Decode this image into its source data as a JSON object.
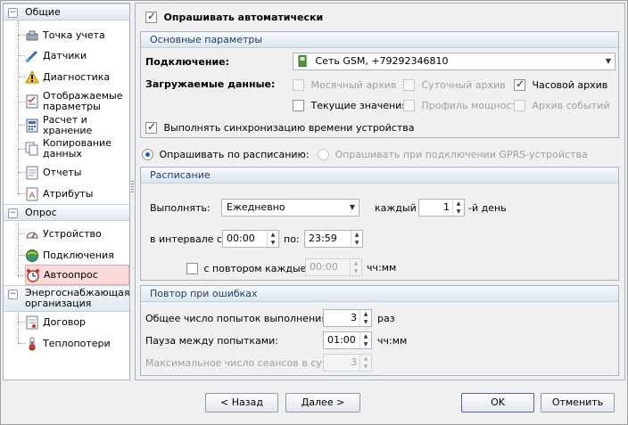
{
  "sidebar": {
    "groups": [
      {
        "label": "Общие",
        "toggle": "−"
      },
      {
        "label": "Опрос",
        "toggle": "−"
      },
      {
        "label": "Энергоснабжающая организация",
        "toggle": "−"
      }
    ],
    "items": [
      {
        "label": "Точка учета",
        "icon": "meter-point-icon"
      },
      {
        "label": "Датчики",
        "icon": "sensor-icon"
      },
      {
        "label": "Диагностика",
        "icon": "warning-icon"
      },
      {
        "label": "Отображаемые параметры",
        "icon": "checklist-icon"
      },
      {
        "label": "Расчет и хранение",
        "icon": "calculator-icon"
      },
      {
        "label": "Копирование данных",
        "icon": "copy-icon"
      },
      {
        "label": "Отчеты",
        "icon": "report-icon"
      },
      {
        "label": "Атрибуты",
        "icon": "attributes-icon"
      },
      {
        "label": "Устройство",
        "icon": "device-icon"
      },
      {
        "label": "Подключения",
        "icon": "connections-icon"
      },
      {
        "label": "Автоопрос",
        "icon": "alarm-clock-icon"
      },
      {
        "label": "Договор",
        "icon": "contract-icon"
      },
      {
        "label": "Теплопотери",
        "icon": "heat-loss-icon"
      }
    ]
  },
  "main": {
    "auto_poll_label": "Опрашивать автоматически",
    "auto_poll_checked": true,
    "basic": {
      "title": "Основные параметры",
      "connection_label": "Подключение:",
      "connection_value": "Сеть GSM, +79292346810",
      "data_label": "Загружаемые данные:",
      "options": [
        {
          "label": "Месячный архив",
          "checked": false,
          "enabled": false
        },
        {
          "label": "Суточный архив",
          "checked": false,
          "enabled": false
        },
        {
          "label": "Часовой архив",
          "checked": true,
          "enabled": true
        },
        {
          "label": "Текущие значения",
          "checked": false,
          "enabled": true
        },
        {
          "label": "Профиль мощности",
          "checked": false,
          "enabled": false
        },
        {
          "label": "Архив событий",
          "checked": false,
          "enabled": false
        }
      ],
      "sync_label": "Выполнять синхронизацию времени устройства",
      "sync_checked": true
    },
    "mode": {
      "schedule_label": "Опрашивать по расписанию:",
      "gprs_label": "Опрашивать при подключении GPRS-устройства"
    },
    "schedule": {
      "title": "Расписание",
      "run_label": "Выполнять:",
      "run_value": "Ежедневно",
      "every_label": "каждый",
      "every_value": "1",
      "every_suffix": "-й день",
      "interval_label": "в интервале с:",
      "from_value": "00:00",
      "to_label": "по:",
      "to_value": "23:59",
      "repeat_label": "с повтором каждые:",
      "repeat_value": "00:00",
      "repeat_unit": "чч:мм"
    },
    "retry": {
      "title": "Повтор при ошибках",
      "attempts_label": "Общее число попыток выполнения:",
      "attempts_value": "3",
      "attempts_unit": "раз",
      "pause_label": "Пауза между попытками:",
      "pause_value": "01:00",
      "pause_unit": "чч:мм",
      "max_sessions_label": "Максимальное число сеансов в сутки:",
      "max_sessions_value": "3"
    }
  },
  "footer": {
    "back": "< Назад",
    "next": "Далее >",
    "ok": "OK",
    "cancel": "Отменить"
  }
}
